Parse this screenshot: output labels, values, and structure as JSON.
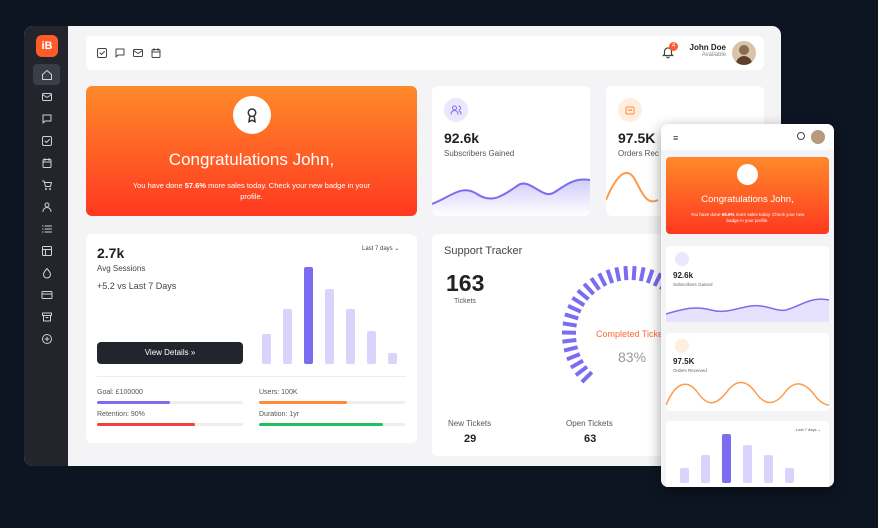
{
  "app": {
    "logo": "iB"
  },
  "sidebar": {
    "items": [
      {
        "icon": "home-icon",
        "active": true
      },
      {
        "icon": "mail-icon"
      },
      {
        "icon": "chat-icon"
      },
      {
        "icon": "checkbox-icon"
      },
      {
        "icon": "calendar-icon"
      },
      {
        "icon": "cart-icon"
      },
      {
        "icon": "user-icon"
      },
      {
        "icon": "list-icon"
      },
      {
        "icon": "layout-icon"
      },
      {
        "icon": "drop-icon"
      },
      {
        "icon": "credit-card-icon"
      },
      {
        "icon": "archive-icon"
      },
      {
        "icon": "plus-circle-icon"
      }
    ]
  },
  "topbar": {
    "icons": [
      "checkbox-icon",
      "chat-icon",
      "mail-icon",
      "calendar-icon"
    ],
    "notification_count": "4",
    "user_name": "John Doe",
    "user_status": "Available"
  },
  "congrats": {
    "title": "Congratulations John,",
    "text_before": "You have done ",
    "highlight": "57.6%",
    "text_after": " more sales today. Check your new badge in your profile."
  },
  "subscribers": {
    "value": "92.6k",
    "label": "Subscribers Gained"
  },
  "orders": {
    "value": "97.5K",
    "label": "Orders Received",
    "label_clipped": "Orders Rec"
  },
  "sessions": {
    "value": "2.7k",
    "label": "Avg Sessions",
    "delta": "+5.2 vs Last 7 Days",
    "range": "Last 7 days",
    "button": "View Details",
    "button_arrow": "»",
    "bars": [
      0.3,
      0.55,
      0.97,
      0.75,
      0.55,
      0.33,
      0.11
    ],
    "goal_label": "Goal: £100000",
    "goal_pct": 0.5,
    "users_label": "Users: 100K",
    "users_pct": 0.6,
    "retention_label": "Retention: 90%",
    "retention_pct": 0.67,
    "duration_label": "Duration: 1yr",
    "duration_pct": 0.85
  },
  "support": {
    "title": "Support Tracker",
    "tickets_value": "163",
    "tickets_label": "Tickets",
    "completed_label": "Completed Tickets",
    "completed_label_clipped": "Completed Ticke",
    "completed_value": "83%",
    "completed_fraction": 0.83,
    "new_label": "New Tickets",
    "new_value": "29",
    "open_label": "Open Tickets",
    "open_value": "63"
  },
  "mobile": {
    "congrats_title": "Congratulations John,",
    "congrats_text_before": "You have done ",
    "congrats_highlight": "68.6%",
    "congrats_text_after": " more sales today. Check your new badge in your profile.",
    "subs_value": "92.6k",
    "subs_label": "Subscribers Gained",
    "orders_value": "97.5K",
    "orders_label": "Orders Received",
    "range": "Last 7 days",
    "bars": [
      0.3,
      0.55,
      0.97,
      0.75,
      0.55,
      0.3
    ]
  },
  "colors": {
    "accent": "#7b6cf0",
    "orange": "#ff7a2a",
    "red": "#ff3820",
    "green": "#20c060"
  }
}
